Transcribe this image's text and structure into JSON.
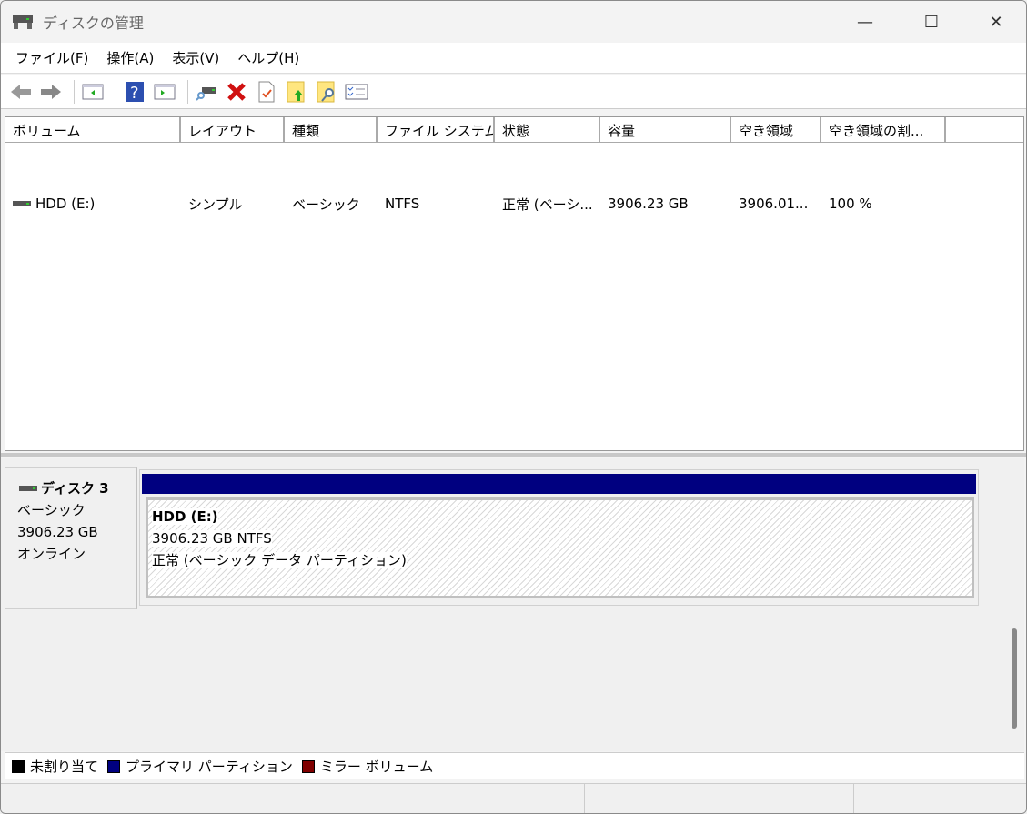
{
  "window": {
    "title": "ディスクの管理",
    "minimize": "—",
    "maximize": "☐",
    "close": "✕"
  },
  "menu": [
    "ファイル(F)",
    "操作(A)",
    "表示(V)",
    "ヘルプ(H)"
  ],
  "toolbar": [
    "back-icon",
    "forward-icon",
    "show-hide-console-tree-icon",
    "help-icon",
    "show-action-pane-icon",
    "connect-disk-icon",
    "delete-icon",
    "properties-icon",
    "import-icon",
    "find-icon",
    "settings-list-icon"
  ],
  "list": {
    "columns": [
      "ボリューム",
      "レイアウト",
      "種類",
      "ファイル システム",
      "状態",
      "容量",
      "空き領域",
      "空き領域の割..."
    ],
    "rows": [
      [
        "HDD (E:)",
        "シンプル",
        "ベーシック",
        "NTFS",
        "正常 (ベーシ...",
        "3906.23 GB",
        "3906.01...",
        "100 %"
      ]
    ]
  },
  "disk": {
    "name": "ディスク 3",
    "type": "ベーシック",
    "size": "3906.23 GB",
    "status": "オンライン"
  },
  "partition": {
    "name": "HDD  (E:)",
    "size_fs": "3906.23 GB NTFS",
    "status": "正常 (ベーシック データ パーティション)",
    "color": "#000080"
  },
  "legend": [
    {
      "label": "未割り当て",
      "color": "#000000"
    },
    {
      "label": "プライマリ パーティション",
      "color": "#000080"
    },
    {
      "label": "ミラー ボリューム",
      "color": "#800000"
    }
  ]
}
